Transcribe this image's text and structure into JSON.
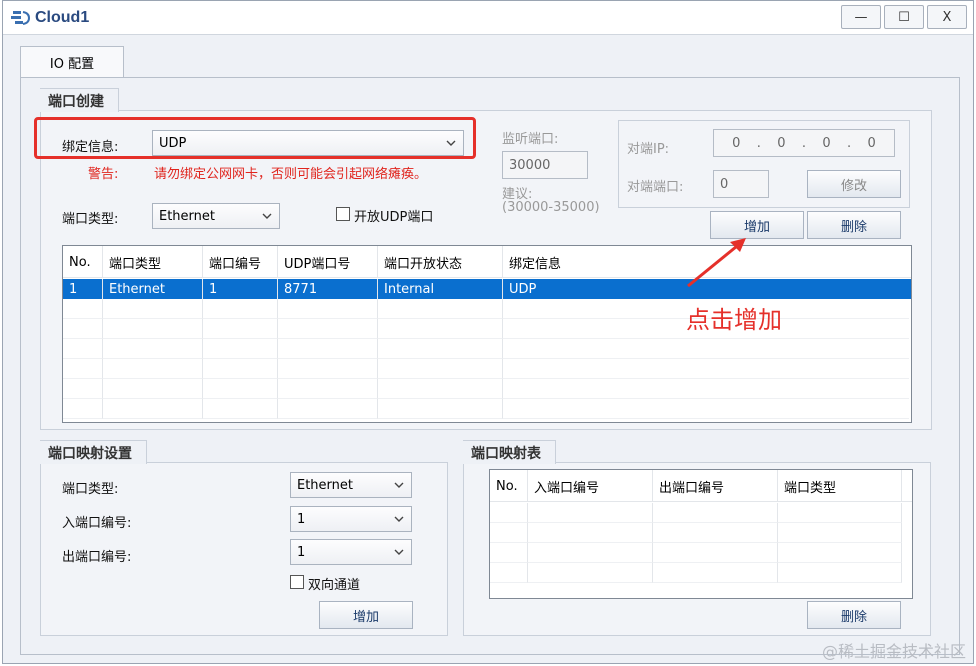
{
  "window": {
    "title": "Cloud1",
    "min_label": "—",
    "max_label": "☐",
    "close_label": "X"
  },
  "tabs": [
    {
      "label": "IO 配置"
    }
  ],
  "port_create": {
    "group_title": "端口创建",
    "bind_label": "绑定信息:",
    "bind_value": "UDP",
    "warn_label": "警告:",
    "warn_text": "请勿绑定公网网卡，否则可能会引起网络瘫痪。",
    "listen_label": "监听端口:",
    "listen_value": "30000",
    "suggest_label": "建议:",
    "suggest_range": "(30000-35000)",
    "port_type_label": "端口类型:",
    "port_type_value": "Ethernet",
    "open_udp_label": "开放UDP端口",
    "peer_ip_label": "对端IP:",
    "peer_ip_octets": [
      "0",
      "0",
      "0",
      "0"
    ],
    "peer_port_label": "对端端口:",
    "peer_port_value": "0",
    "modify_label": "修改",
    "add_label": "增加",
    "delete_label": "删除"
  },
  "port_table": {
    "columns": [
      "No.",
      "端口类型",
      "端口编号",
      "UDP端口号",
      "端口开放状态",
      "绑定信息"
    ],
    "rows": [
      [
        "1",
        "Ethernet",
        "1",
        "8771",
        "Internal",
        "UDP"
      ]
    ]
  },
  "annotation": {
    "text": "点击增加",
    "color": "#e5302a"
  },
  "port_map_settings": {
    "group_title": "端口映射设置",
    "port_type_label": "端口类型:",
    "port_type_value": "Ethernet",
    "in_port_label": "入端口编号:",
    "in_port_value": "1",
    "out_port_label": "出端口编号:",
    "out_port_value": "1",
    "bidirectional_label": "双向通道",
    "add_label": "增加"
  },
  "port_map_table": {
    "group_title": "端口映射表",
    "columns": [
      "No.",
      "入端口编号",
      "出端口编号",
      "端口类型"
    ],
    "delete_label": "删除"
  },
  "watermark": "@稀土掘金技术社区",
  "colors": {
    "selected_row": "#0a6fcf",
    "highlight": "#e5302a",
    "title": "#2a4a80"
  }
}
